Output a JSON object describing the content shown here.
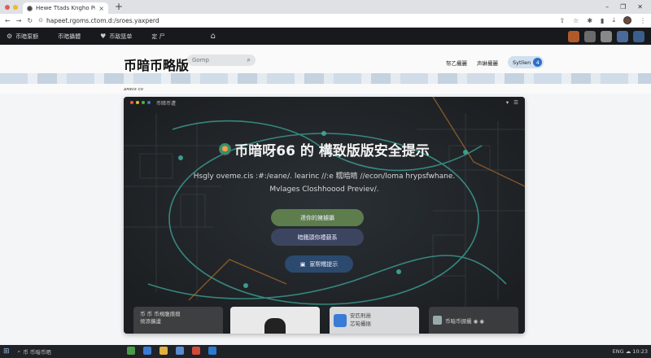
{
  "browser": {
    "tab_title": "Hewe Ttads Kngho Preds",
    "new_tab": "+",
    "close_tab": "×",
    "url": "hapeet.rgoms.ctom.d:/sroes.yaxperd",
    "window_controls": [
      "–",
      "❐",
      "✕"
    ]
  },
  "site_nav": {
    "items": [
      "币暗泵额",
      "币暗攝體",
      "币敌篮单",
      "定 尸"
    ]
  },
  "header": {
    "brand": "币暗币略版",
    "search_placeholder": "Gomp",
    "links": [
      "帑乙攝麗",
      "声綝攝麗"
    ],
    "pill_label": "Sytlien",
    "pill_badge": "4",
    "tiny_label": "ᴀᴍᴇᴄᴇ ᴄᴏ"
  },
  "card": {
    "app_label": "币暗币遭",
    "title": "币暗呀66 的 構致版版安全提示",
    "subtitle_line1": "Hsgly oveme.cis :#:/eane/. learinc //:e 糯暗睛 //econ/loma hrypsfwhane.",
    "subtitle_line2": "Mvlages Closhhoood Previev/.",
    "btn_primary": "達你的擁擄攝",
    "btn_secondary": "暗餓頭你禮藐系",
    "btn_tertiary": "家帮糯提示",
    "thumb1_line1": "币 币 币規腹擔擅",
    "thumb1_line2": "倾添擴盪",
    "thumb3_line1": "安匹刑甾",
    "thumb3_line2": "芯筍攝摳",
    "thumb4_text": "币暗币挪攝 ◉ ◉"
  },
  "taskbar": {
    "search_text": "币 币暗币晒",
    "tray_text": "ENG ☁ 10:23"
  },
  "colors": {
    "nav_bg": "#17191c",
    "accent_blue": "#2d6fc9",
    "btn_green": "#5d7d4d",
    "btn_indigo": "#3c4560",
    "btn_blue": "#2b4a6e"
  }
}
